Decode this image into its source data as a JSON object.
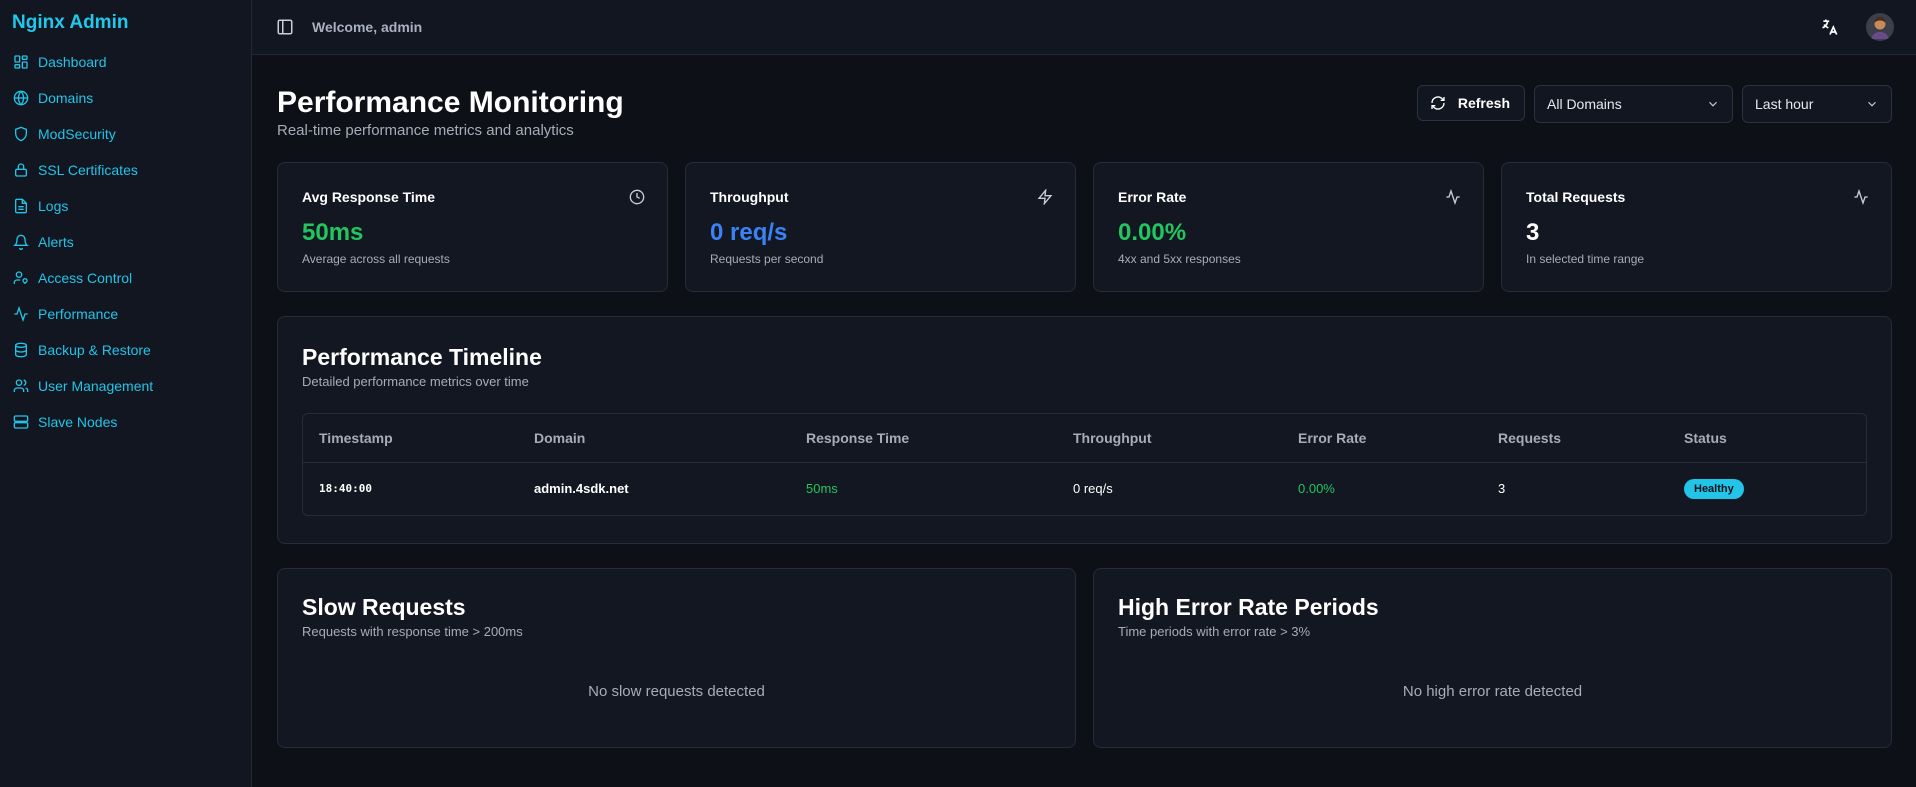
{
  "sidebar": {
    "brand": "Nginx Admin",
    "items": [
      {
        "label": "Dashboard",
        "icon": "dashboard-icon"
      },
      {
        "label": "Domains",
        "icon": "globe-icon"
      },
      {
        "label": "ModSecurity",
        "icon": "shield-icon"
      },
      {
        "label": "SSL Certificates",
        "icon": "lock-icon"
      },
      {
        "label": "Logs",
        "icon": "file-icon"
      },
      {
        "label": "Alerts",
        "icon": "bell-icon"
      },
      {
        "label": "Access Control",
        "icon": "user-key-icon"
      },
      {
        "label": "Performance",
        "icon": "activity-icon"
      },
      {
        "label": "Backup & Restore",
        "icon": "database-icon"
      },
      {
        "label": "User Management",
        "icon": "users-icon"
      },
      {
        "label": "Slave Nodes",
        "icon": "server-icon"
      }
    ]
  },
  "topbar": {
    "welcome": "Welcome, admin"
  },
  "page": {
    "title": "Performance Monitoring",
    "subtitle": "Real-time performance metrics and analytics"
  },
  "controls": {
    "refresh_label": "Refresh",
    "domain_select": "All Domains",
    "time_select": "Last hour"
  },
  "stats": [
    {
      "label": "Avg Response Time",
      "value": "50ms",
      "desc": "Average across all requests",
      "color": "#22c55e",
      "icon": "clock-icon"
    },
    {
      "label": "Throughput",
      "value": "0 req/s",
      "desc": "Requests per second",
      "color": "#3b82f6",
      "icon": "zap-icon"
    },
    {
      "label": "Error Rate",
      "value": "0.00%",
      "desc": "4xx and 5xx responses",
      "color": "#22c55e",
      "icon": "activity-icon"
    },
    {
      "label": "Total Requests",
      "value": "3",
      "desc": "In selected time range",
      "color": "#ffffff",
      "icon": "activity-icon"
    }
  ],
  "timeline": {
    "title": "Performance Timeline",
    "subtitle": "Detailed performance metrics over time",
    "columns": [
      "Timestamp",
      "Domain",
      "Response Time",
      "Throughput",
      "Error Rate",
      "Requests",
      "Status"
    ],
    "rows": [
      {
        "timestamp": "18:40:00",
        "domain": "admin.4sdk.net",
        "response_time": "50ms",
        "throughput": "0 req/s",
        "error_rate": "0.00%",
        "requests": "3",
        "status": "Healthy"
      }
    ]
  },
  "slow_requests": {
    "title": "Slow Requests",
    "subtitle": "Requests with response time > 200ms",
    "empty": "No slow requests detected"
  },
  "high_error": {
    "title": "High Error Rate Periods",
    "subtitle": "Time periods with error rate > 3%",
    "empty": "No high error rate detected"
  },
  "colors": {
    "accent": "#22c4e8",
    "success": "#22c55e",
    "info": "#3b82f6",
    "background": "#0d1017",
    "card": "#131721"
  }
}
